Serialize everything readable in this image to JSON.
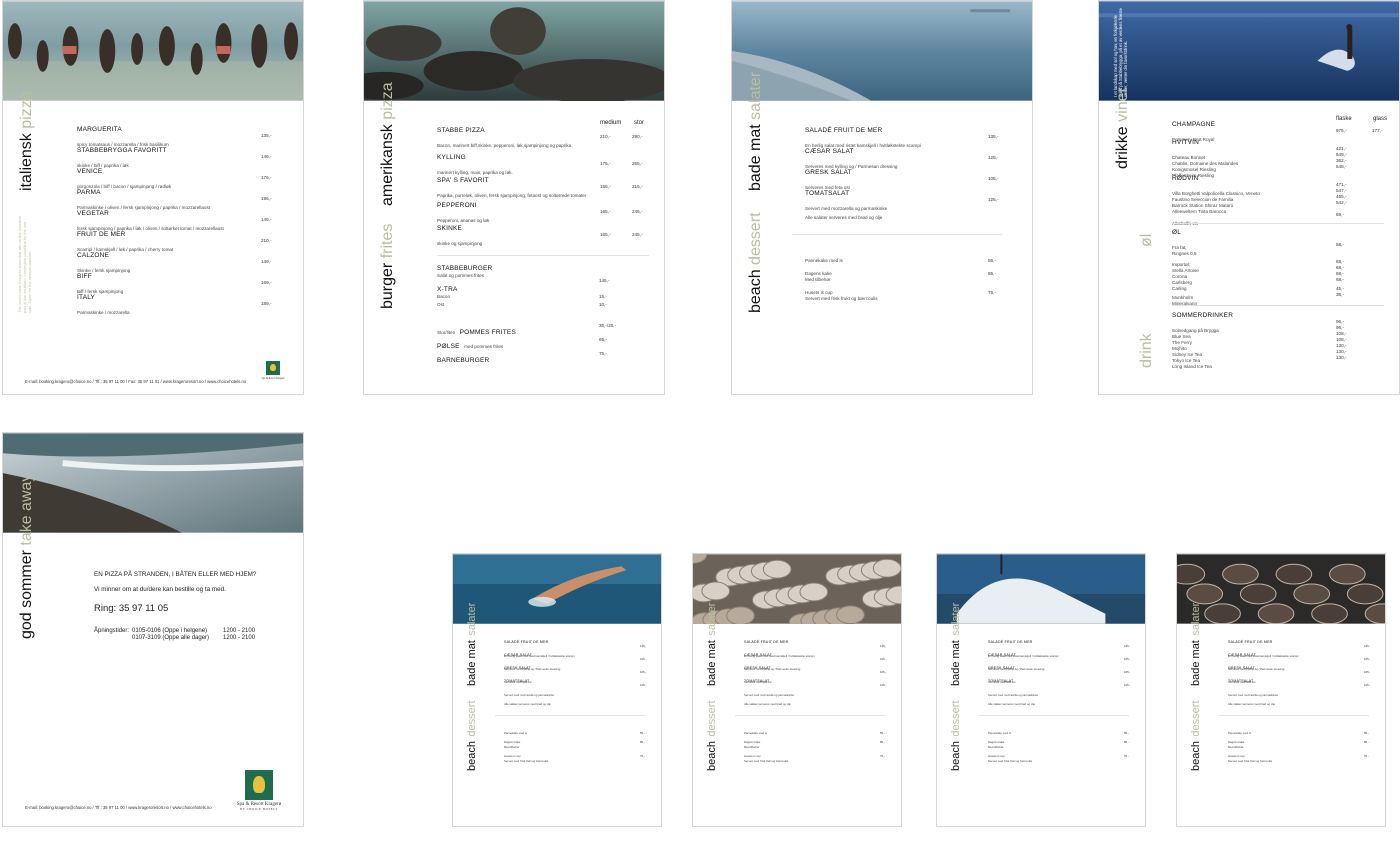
{
  "colors": {
    "accent": "#b9bf9e",
    "border": "#d6d6d6",
    "logo_green": "#1f6d4e",
    "logo_gold": "#e7c23d"
  },
  "footer": {
    "contact_1": "E-mail: booking.kragero@choice.no  /  Tlf.: 35 97 11 00  /  Fax: 35 97 11 01  / www.krageroresort.no  / www.choicehotels.no",
    "contact_2": "E-mail: booking.kragero@choice.no  /  Tlf.: 35 97 11 00  /  www.krageroresort.no  /  www.choicehotels.no",
    "logo_name": "Spa & Resort Kragerø",
    "logo_sub": "by choice hotels",
    "logo_mark": "Quality Resort"
  },
  "pizza": {
    "heading_dark": "italiensk",
    "heading_light": "pizza",
    "side_note": "The world-class Kragerø-hotel that sits on the sunniest part of the southern Norwegian coastline by the sea side. Open for the season summer.",
    "items": [
      {
        "name": "MARGUERITA",
        "desc": "spicy tomatsaus / mozzarella / frisk basilikum",
        "price": "135,-"
      },
      {
        "name": "STABBEBRYGGA FAVORITT",
        "desc": "skinke / biff / paprika / løk",
        "price": "146,-"
      },
      {
        "name": "VENICE",
        "desc": "gorgonzola / biff / bacon / sjampinjong / rødløk",
        "price": "176,-"
      },
      {
        "name": "PARMA",
        "desc": "Parmaskinke / oliven / fersk sjampinjong / paprika / mozzarellaost",
        "price": "196,-"
      },
      {
        "name": "VEGETAR",
        "desc": "fersk sjampinjong / paprika / løk / oliven / soltørket tomat / mozzarellaost",
        "price": "145,-"
      },
      {
        "name": "FRUIT DE MER",
        "desc": "Scampi / kamskjell / løk / paprika / cherry tomat",
        "price": "210,-"
      },
      {
        "name": "CALZONE",
        "desc": "Skinke / fersk sjampinjong",
        "price": "149,-"
      },
      {
        "name": "BIFF",
        "desc": "Biff / fersk sjampinjong",
        "price": "169,-"
      },
      {
        "name": "ITALY",
        "desc": "Parmaskinke / mozzarella",
        "price": "189,-"
      }
    ]
  },
  "american": {
    "heading_dark": "amerikansk",
    "heading_light": "pizza",
    "col_medium": "medium",
    "col_large": "stor",
    "items": [
      {
        "name": "STABBE PIZZA",
        "desc": "Bacon, marinert biff,skinke, pepperoni, løk,sjampinjong og paprika.",
        "p1": "210,-",
        "p2": "290,-"
      },
      {
        "name": "KYLLING",
        "desc": "marinert kylling, mais, paprika og løk.",
        "p1": "175,-",
        "p2": "265,-"
      },
      {
        "name": "SPA' S FAVORIT",
        "desc": "Paprika, purreløk, oliven, fersk sjampinjong, fetaost og soltørrede tomater",
        "p1": "155,-",
        "p2": "215,-"
      },
      {
        "name": "PEPPERONI",
        "desc": "Pepperoni, ananas og løk",
        "p1": "165,-",
        "p2": "245,-"
      },
      {
        "name": "SKINKE",
        "desc": "skinke og sjampinjong",
        "p1": "165,-",
        "p2": "245,-"
      }
    ],
    "burger_dark": "burger",
    "burger_light": "frites",
    "burger_name": "STABBEBURGER",
    "burger_desc": "Salat og pommes frites",
    "burger_price": "145,-",
    "extra_name": "X-TRA",
    "extra_1": "Bacon",
    "extra_1_price": "15,-",
    "extra_2": "Ost",
    "extra_2_price": "10,-",
    "fries_prefix": "Stor/liten",
    "fries_name": "POMMES FRITES",
    "fries_price": "35,-/20,-",
    "sausage_name": "PØLSE",
    "sausage_desc": "med pommes frites",
    "sausage_price": "65,-",
    "kids_name": "BARNEBURGER",
    "kids_price": "75,-"
  },
  "salads": {
    "heading_dark": "bade mat",
    "heading_light": "salater",
    "items": [
      {
        "name": "SALADÉ FRUIT DE MER",
        "desc": "En herlig salat med ristet kamskjell / hvitløkstekte scampi",
        "price": "135,-"
      },
      {
        "name": "CÆSAR SALAT",
        "desc": "Serveres med kylling og / Parmesan dressing",
        "price": "125,-"
      },
      {
        "name": "GRESK SALAT",
        "desc": "Serveres med feta ost",
        "price": "105,-"
      },
      {
        "name": "TOMATSALAT",
        "desc": "Servert med mozzarella og parmaskinke",
        "price": "125,-"
      }
    ],
    "note": "Alle salater serveres med brød og olje",
    "dessert_dark": "beach",
    "dessert_light": "dessert",
    "desserts": [
      {
        "name": "Pannekake med is",
        "desc": "",
        "price": "55,-"
      },
      {
        "name": "Dagens kake",
        "desc": "Med tilbehør",
        "price": "85,-"
      },
      {
        "name": "Husets is cup",
        "desc": "Servert med frisk frukt og bærcoulis",
        "price": "75,-"
      }
    ]
  },
  "drinks": {
    "heading_dark": "drikke",
    "heading_light": "viner",
    "photo_caption": "I et landskap med sol og hav, en forkjølende drink på Stabbebrygga, på et av verdens fineste steder, venter din favorittdrink.",
    "col_bottle": "flaske",
    "col_glass": "glass",
    "champagne": {
      "name": "CHAMPAGNE",
      "wine": "Pommery Brut Royal",
      "bottle": "975,-",
      "glass": "177,-"
    },
    "white_title": "HVITVIN",
    "white": [
      {
        "name": "Chateau Bonnet",
        "price": "421,-"
      },
      {
        "name": "Chablis, Domaine des Malandes",
        "price": "649,-"
      },
      {
        "name": "Konigsmosel Riesling",
        "price": "362,-"
      },
      {
        "name": "Pfaffenheim Riesling",
        "price": "548,-"
      }
    ],
    "red_title": "RØDVIN",
    "red": [
      {
        "name": "Villa Borghetti Valpolicella Classico, Veneto",
        "price": "471,-"
      },
      {
        "name": "Faustino Seleccion de Familia",
        "price": "547,-"
      },
      {
        "name": "Barrock Station Shiraz Mataro",
        "price": "465,-"
      },
      {
        "name": "Alleeweltem Tinta Barocca",
        "price": "542,-"
      }
    ],
    "house_wine": "Alkoholfri vin",
    "house_wine_price": "69,-",
    "beer_light": "øl",
    "beer_title": "ØL",
    "beer_tap": "Fra fat,",
    "beer_tap_item": "Ringnes 0,5",
    "beer_tap_price": "58,-",
    "import_title": "Importøl;",
    "imports": [
      {
        "name": "Stella Artoise",
        "price": "68,-"
      },
      {
        "name": "Corona",
        "price": "68,-"
      },
      {
        "name": "Carlsberg",
        "price": "68,-"
      },
      {
        "name": "Carling",
        "price": "68,-"
      }
    ],
    "soft": [
      {
        "name": "Munkholm",
        "price": "45,-"
      },
      {
        "name": "Mineralvann",
        "price": "38,-"
      }
    ],
    "drink_light": "drink",
    "summer_title": "SOMMERDRINKER",
    "summer": [
      {
        "name": "Solnedgang på Brygga",
        "price": "96,-"
      },
      {
        "name": "Blue Sea",
        "price": "96,-"
      },
      {
        "name": "The Ferry",
        "price": "108,-"
      },
      {
        "name": "Mojhito",
        "price": "108,-"
      },
      {
        "name": "Sidney Ice Tea",
        "price": "130,-"
      },
      {
        "name": "Tokyo Ice Tea",
        "price": "130,-"
      },
      {
        "name": "Long Island Ice Tea",
        "price": "130,-"
      }
    ]
  },
  "takeaway": {
    "heading_dark": "god sommer",
    "heading_light": "take away",
    "line_1": "EN PIZZA PÅ STRANDEN, I BÅTEN ELLER MED HJEM?",
    "line_2": "Vi minner om at du/dere kan bestille og ta med.",
    "phone": "Ring: 35 97 11 05",
    "hours_label": "Åpningstider:",
    "hours_1": "0105-0106 (Oppe i helgene)",
    "hours_1_time": "1200 - 2100",
    "hours_2": "0107-3109 (Oppe alle dager)",
    "hours_2_time": "1200 - 2100"
  }
}
